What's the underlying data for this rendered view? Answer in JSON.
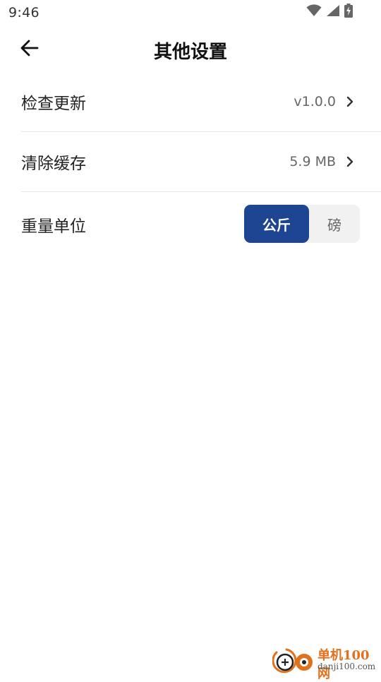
{
  "status_bar": {
    "time": "9:46",
    "icons": [
      "wifi-icon",
      "signal-icon",
      "battery-charging-icon"
    ]
  },
  "header": {
    "title": "其他设置",
    "back_icon": "arrow-left-icon"
  },
  "settings": {
    "check_update": {
      "label": "检查更新",
      "value": "v1.0.0"
    },
    "clear_cache": {
      "label": "清除缓存",
      "value": "5.9 MB"
    },
    "weight_unit": {
      "label": "重量单位",
      "options": [
        "公斤",
        "磅"
      ],
      "selected": "公斤"
    }
  },
  "watermark": {
    "title": "单机100网",
    "url": "danji100.com"
  },
  "colors": {
    "accent": "#1e4591",
    "segment_bg": "#f1f1f1",
    "watermark_orange": "#e2711d"
  }
}
